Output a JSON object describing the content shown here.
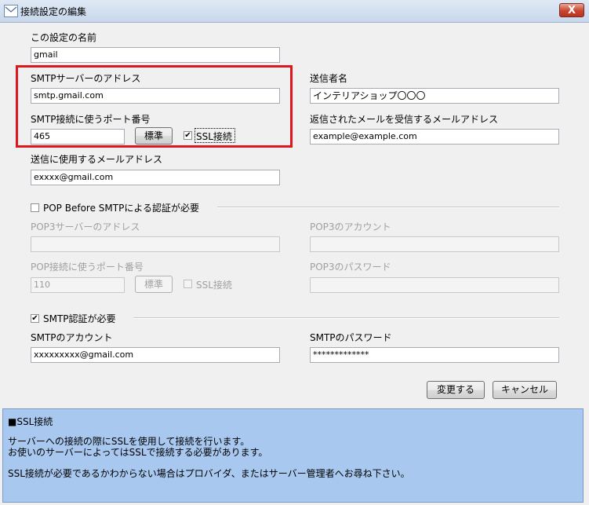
{
  "window": {
    "title": "接続設定の編集",
    "close_label": "X"
  },
  "fields": {
    "setting_name": {
      "label": "この設定の名前",
      "value": "gmail"
    },
    "smtp_server": {
      "label": "SMTPサーバーのアドレス",
      "value": "smtp.gmail.com"
    },
    "smtp_port": {
      "label": "SMTP接続に使うポート番号",
      "value": "465",
      "default_button": "標準",
      "ssl_label": "SSL接続",
      "ssl_checked": true
    },
    "sender_email": {
      "label": "送信に使用するメールアドレス",
      "value": "exxxx@gmail.com"
    },
    "sender_name": {
      "label": "送信者名",
      "value": "インテリアショップ〇〇〇"
    },
    "reply_email": {
      "label": "返信されたメールを受信するメールアドレス",
      "value": "example@example.com"
    }
  },
  "pop_before_smtp": {
    "label": "POP Before SMTPによる認証が必要",
    "checked": false,
    "pop3_server": {
      "label": "POP3サーバーのアドレス",
      "value": ""
    },
    "pop3_account": {
      "label": "POP3のアカウント",
      "value": ""
    },
    "pop_port": {
      "label": "POP接続に使うポート番号",
      "value": "110",
      "default_button": "標準",
      "ssl_label": "SSL接続",
      "ssl_checked": false
    },
    "pop3_password": {
      "label": "POP3のパスワード",
      "value": ""
    }
  },
  "smtp_auth": {
    "label": "SMTP認証が必要",
    "checked": true,
    "account": {
      "label": "SMTPのアカウント",
      "value": "xxxxxxxxx@gmail.com"
    },
    "password": {
      "label": "SMTPのパスワード",
      "value": "*************"
    }
  },
  "buttons": {
    "ok": "変更する",
    "cancel": "キャンセル"
  },
  "help": {
    "title": "■SSL接続",
    "lines": [
      "サーバーへの接続の際にSSLを使用して接続を行います。",
      "お使いのサーバーによってはSSLで接続する必要があります。",
      "SSL接続が必要であるかわからない場合はプロバイダ、またはサーバー管理者へお尋ね下さい。"
    ]
  },
  "check_mark": "✔"
}
